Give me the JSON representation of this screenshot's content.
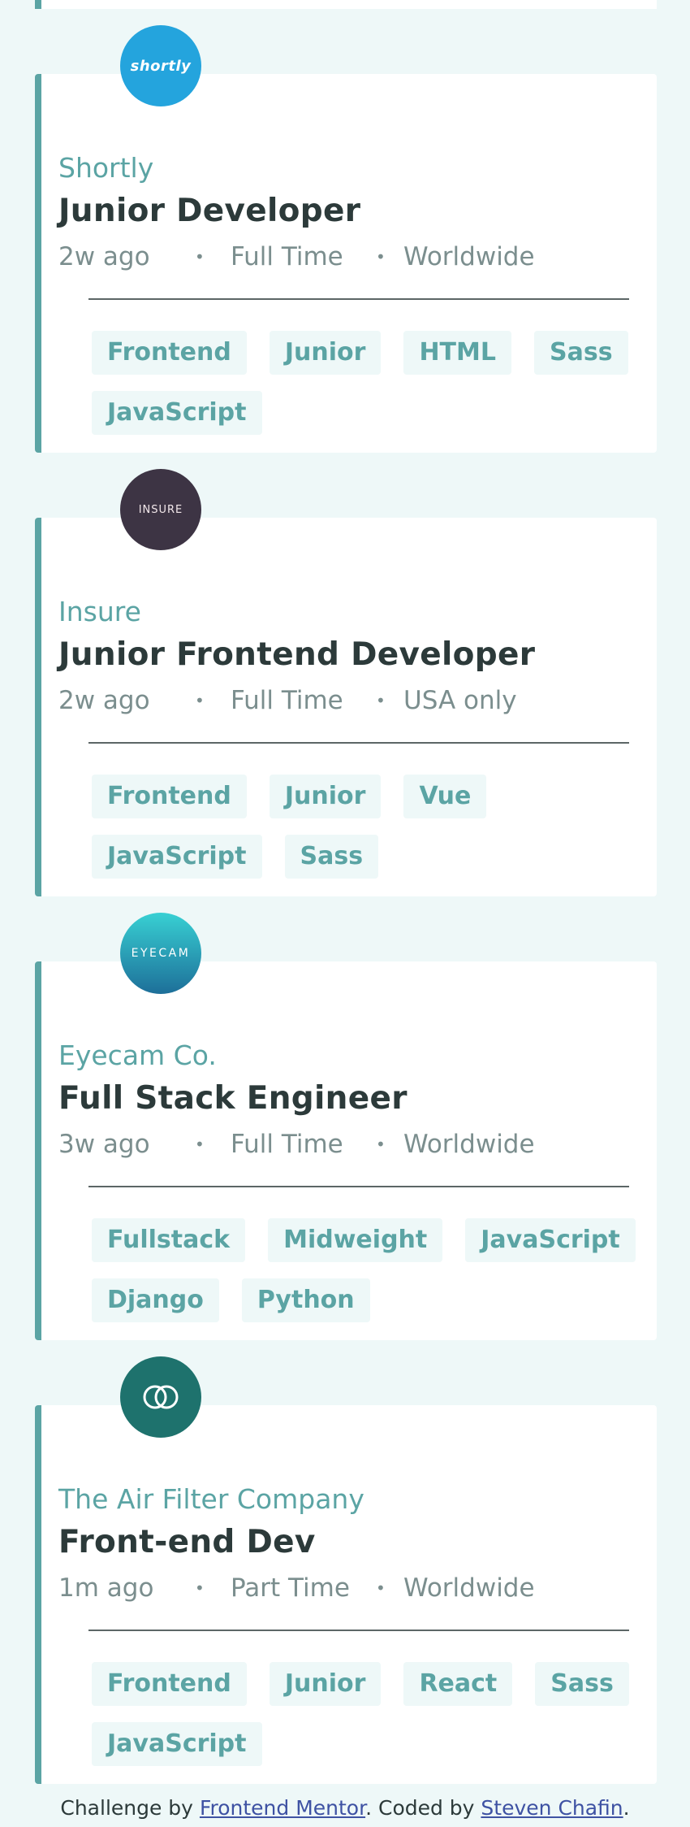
{
  "jobs": [
    {
      "logo_text": "shortly",
      "company": "Shortly",
      "position": "Junior Developer",
      "posted": "2w ago",
      "contract": "Full Time",
      "location": "Worldwide",
      "tags": [
        "Frontend",
        "Junior",
        "HTML",
        "Sass",
        "JavaScript"
      ]
    },
    {
      "logo_text": "INSURE",
      "company": "Insure",
      "position": "Junior Frontend Developer",
      "posted": "2w ago",
      "contract": "Full Time",
      "location": "USA only",
      "tags": [
        "Frontend",
        "Junior",
        "Vue",
        "JavaScript",
        "Sass"
      ]
    },
    {
      "logo_text": "EYECAM",
      "company": "Eyecam Co.",
      "position": "Full Stack Engineer",
      "posted": "3w ago",
      "contract": "Full Time",
      "location": "Worldwide",
      "tags": [
        "Fullstack",
        "Midweight",
        "JavaScript",
        "Django",
        "Python"
      ]
    },
    {
      "logo_text": "",
      "company": "The Air Filter Company",
      "position": "Front-end Dev",
      "posted": "1m ago",
      "contract": "Part Time",
      "location": "Worldwide",
      "tags": [
        "Frontend",
        "Junior",
        "React",
        "Sass",
        "JavaScript"
      ]
    }
  ],
  "meta_separator": "•",
  "footer": {
    "prefix": "Challenge by",
    "link1": "Frontend Mentor",
    "middle": ". Coded by",
    "link2": "Steven Chafin",
    "suffix": "."
  },
  "colors": {
    "accent": "#5ba4a4",
    "background": "#eef8f8",
    "shortly_logo": "#24a4dd",
    "insure_logo": "#3d3444",
    "eyecam_logo_top": "#38d0d3",
    "eyecam_logo_bottom": "#1d6f99",
    "airfilter_logo": "#1e726d"
  },
  "icons": {
    "airfilter_logo": "interlocking-rings-icon"
  }
}
